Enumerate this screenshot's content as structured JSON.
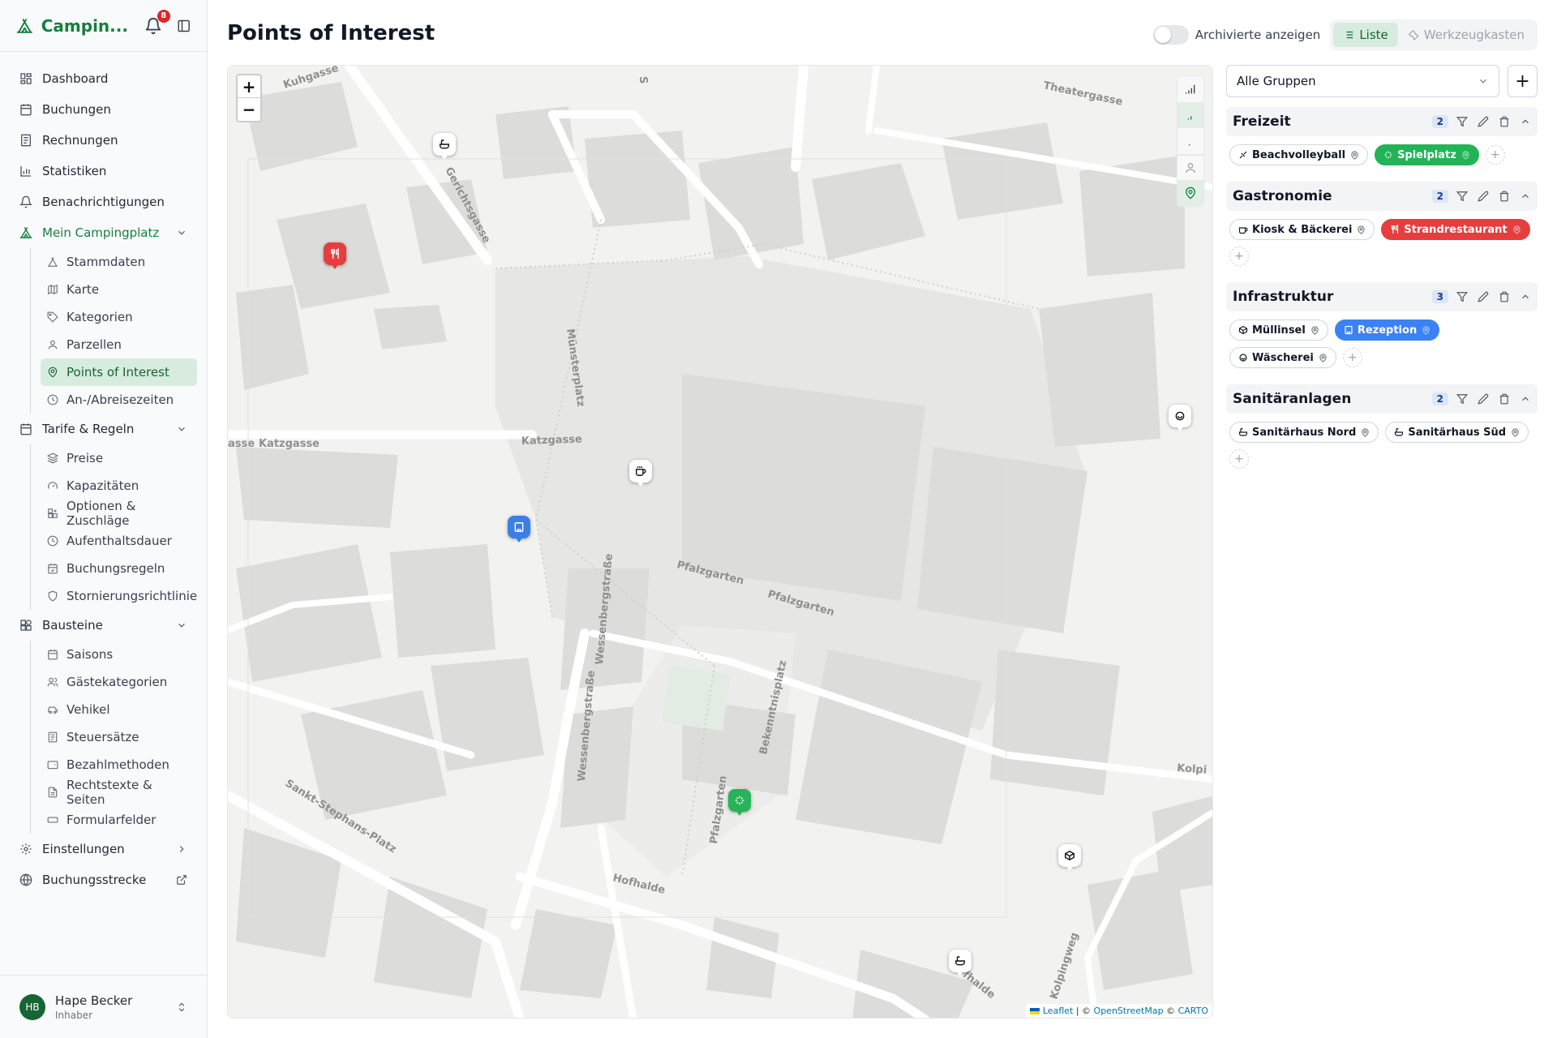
{
  "sidebar": {
    "brand": "Campin...",
    "notification_count": "8",
    "nav": [
      {
        "label": "Dashboard",
        "icon": "dashboard-icon"
      },
      {
        "label": "Buchungen",
        "icon": "calendar-icon"
      },
      {
        "label": "Rechnungen",
        "icon": "receipt-icon"
      },
      {
        "label": "Statistiken",
        "icon": "chart-icon"
      },
      {
        "label": "Benachrichtigungen",
        "icon": "bell-icon"
      }
    ],
    "campground_group": {
      "label": "Mein Campingplatz",
      "items": [
        "Stammdaten",
        "Karte",
        "Kategorien",
        "Parzellen",
        "Points of Interest",
        "An-/Abreisezeiten"
      ]
    },
    "tariff_group": {
      "label": "Tarife & Regeln",
      "items": [
        "Preise",
        "Kapazitäten",
        "Optionen & Zuschläge",
        "Aufenthaltsdauer",
        "Buchungsregeln",
        "Stornierungsrichtlinie"
      ]
    },
    "blocks_group": {
      "label": "Bausteine",
      "items": [
        "Saisons",
        "Gästekategorien",
        "Vehikel",
        "Steuersätze",
        "Bezahlmethoden",
        "Rechtstexte & Seiten",
        "Formularfelder"
      ]
    },
    "settings_label": "Einstellungen",
    "booking_route_label": "Buchungsstrecke",
    "user": {
      "initials": "HB",
      "name": "Hape Becker",
      "role": "Inhaber"
    }
  },
  "header": {
    "title": "Points of Interest",
    "archived_label": "Archivierte anzeigen",
    "list_label": "Liste",
    "toolbox_label": "Werkzeugkasten"
  },
  "map": {
    "zoom_in": "+",
    "zoom_out": "−",
    "attribution_leaflet": "Leaflet",
    "attribution_osm": "OpenStreetMap",
    "attribution_carto": "CARTO",
    "street_labels": [
      "Kuhgasse",
      "Theatergasse",
      "Gerichtsgasse",
      "Münsterplatz",
      "Katzgasse",
      "Katzgasse",
      "asse",
      "Pfalzgarten",
      "Pfalzgarten",
      "Wessenbergstraße",
      "Wessenbergstraße",
      "Bekenntnisplatz",
      "Sankt-Stephans-Platz",
      "Pfalzgarten",
      "Hofhalde",
      "Hofhalde",
      "Kolpingweg",
      "Kolpi",
      "S"
    ]
  },
  "panel": {
    "filter_value": "Alle Gruppen",
    "add_label": "+",
    "groups": [
      {
        "title": "Freizeit",
        "count": "2",
        "pois": [
          "Beachvolleyball",
          "Spielplatz"
        ]
      },
      {
        "title": "Gastronomie",
        "count": "2",
        "pois": [
          "Kiosk & Bäckerei",
          "Strandrestaurant"
        ]
      },
      {
        "title": "Infrastruktur",
        "count": "3",
        "pois": [
          "Müllinsel",
          "Rezeption",
          "Wäscherei"
        ]
      },
      {
        "title": "Sanitäranlagen",
        "count": "2",
        "pois": [
          "Sanitärhaus Nord",
          "Sanitärhaus Süd"
        ]
      }
    ]
  },
  "colors": {
    "brand": "#15803d",
    "poi_red": "#e53e3e",
    "poi_green": "#22b357",
    "poi_blue": "#3b82f6"
  }
}
